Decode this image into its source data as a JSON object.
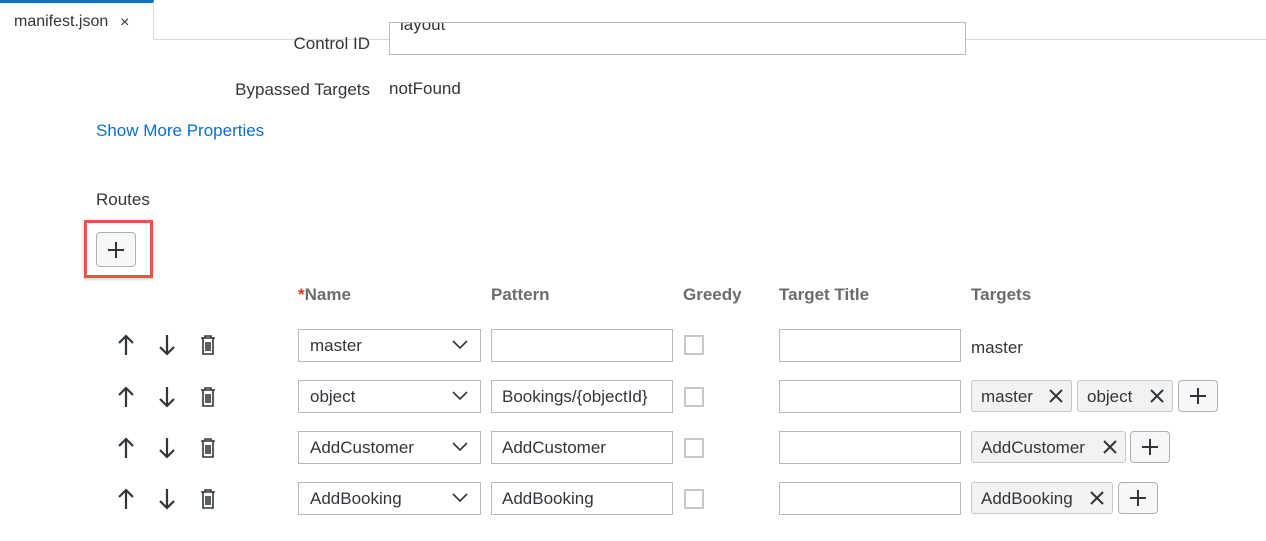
{
  "tabs": [
    {
      "label": "manifest.json",
      "close": "×"
    }
  ],
  "properties": {
    "control_id_label": "Control ID",
    "control_id_value": "layout",
    "bypassed_targets_label": "Bypassed Targets",
    "bypassed_targets_value": "notFound",
    "show_more_link": "Show More Properties"
  },
  "routes": {
    "title": "Routes",
    "add_button_icon": "plus-icon",
    "columns": {
      "name_required": "*",
      "name": "Name",
      "pattern": "Pattern",
      "greedy": "Greedy",
      "target_title": "Target Title",
      "targets": "Targets"
    },
    "rows": [
      {
        "name": "master",
        "pattern": "",
        "greedy": false,
        "target_title": "",
        "targets_text": "master",
        "targets": []
      },
      {
        "name": "object",
        "pattern": "Bookings/{objectId}",
        "greedy": false,
        "target_title": "",
        "targets": [
          "master",
          "object"
        ]
      },
      {
        "name": "AddCustomer",
        "pattern": "AddCustomer",
        "greedy": false,
        "target_title": "",
        "targets": [
          "AddCustomer"
        ]
      },
      {
        "name": "AddBooking",
        "pattern": "AddBooking",
        "greedy": false,
        "target_title": "",
        "targets": [
          "AddBooking"
        ]
      }
    ]
  },
  "colors": {
    "accent": "#0a6ed1",
    "highlight": "#e8534a",
    "required": "#e0352b"
  }
}
